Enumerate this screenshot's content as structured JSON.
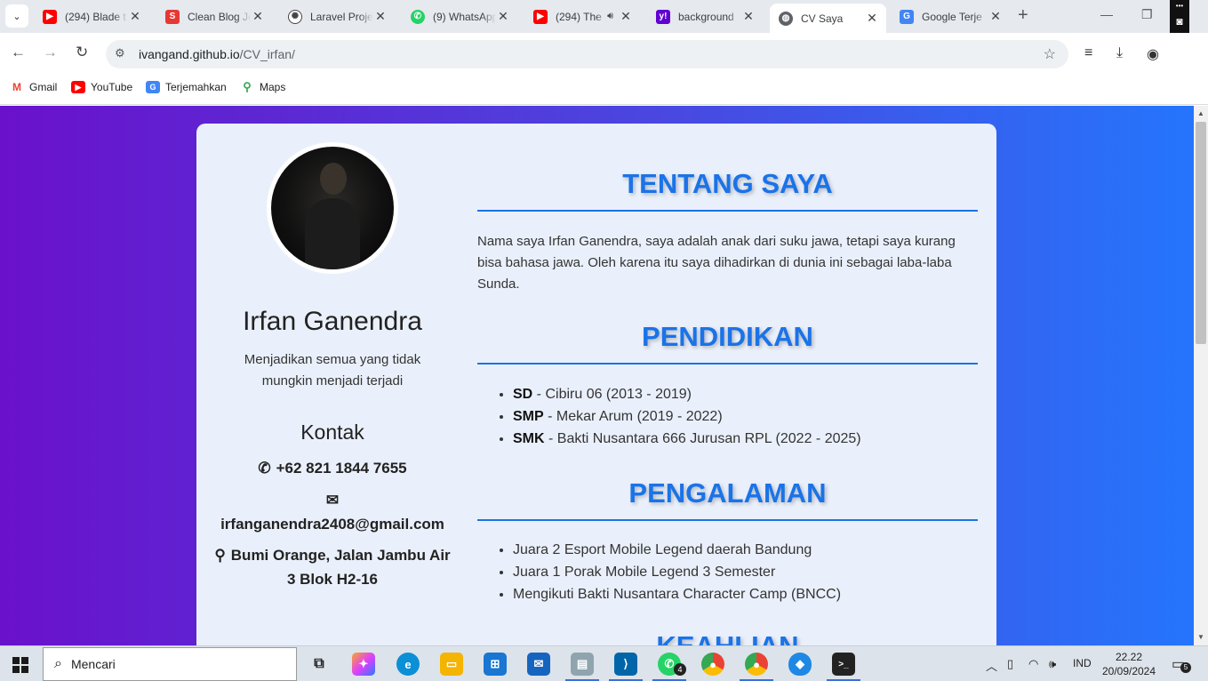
{
  "browser": {
    "tabs": [
      {
        "title": "(294) Blade t",
        "favicon": "youtube-icon",
        "color": "#ff0000"
      },
      {
        "title": "Clean Blog Je",
        "favicon": "s-logo-icon",
        "color": "#e53935"
      },
      {
        "title": "Laravel Proje",
        "favicon": "openai-icon",
        "color": "#444444"
      },
      {
        "title": "(9) WhatsApp",
        "favicon": "whatsapp-icon",
        "color": "#25d366"
      },
      {
        "title": "(294) The",
        "favicon": "youtube-icon",
        "color": "#ff0000"
      },
      {
        "title": "background",
        "favicon": "yahoo-icon",
        "color": "#6001d2"
      },
      {
        "title": "CV Saya",
        "favicon": "globe-icon",
        "color": "#5f6368"
      },
      {
        "title": "Google Terje",
        "favicon": "google-translate-icon",
        "color": "#4285f4"
      }
    ],
    "url_host": "ivangand.github.io",
    "url_path": "/CV_irfan/",
    "bookmarks": [
      {
        "label": "Gmail",
        "icon": "gmail-icon"
      },
      {
        "label": "YouTube",
        "icon": "youtube-icon"
      },
      {
        "label": "Terjemahkan",
        "icon": "google-translate-icon"
      },
      {
        "label": "Maps",
        "icon": "maps-pin-icon"
      }
    ]
  },
  "page": {
    "gradient_colors": [
      "#6a11cb",
      "#2575fc"
    ],
    "accent_color": "#1a73e8",
    "profile": {
      "name": "Irfan Ganendra",
      "tagline": "Menjadikan semua yang tidak mungkin menjadi terjadi",
      "contact_heading": "Kontak",
      "phone": "+62 821 1844 7655",
      "email": "irfanganendra2408@gmail.com",
      "address": "Bumi Orange, Jalan Jambu Air 3 Blok H2-16"
    },
    "about": {
      "title": "TENTANG SAYA",
      "text": "Nama saya Irfan Ganendra, saya adalah anak dari suku jawa, tetapi saya kurang bisa bahasa jawa. Oleh karena itu saya dihadirkan di dunia ini sebagai laba-laba Sunda."
    },
    "education": {
      "title": "PENDIDIKAN",
      "items": [
        {
          "level": "SD",
          "detail": " - Cibiru 06 (2013 - 2019)"
        },
        {
          "level": "SMP",
          "detail": " - Mekar Arum (2019 - 2022)"
        },
        {
          "level": "SMK",
          "detail": " - Bakti Nusantara 666 Jurusan RPL (2022 - 2025)"
        }
      ]
    },
    "experience": {
      "title": "PENGALAMAN",
      "items": [
        "Juara 2 Esport Mobile Legend daerah Bandung",
        "Juara 1 Porak Mobile Legend 3 Semester",
        "Mengikuti Bakti Nusantara Character Camp (BNCC)"
      ]
    },
    "skills": {
      "title": "KEAHLIAN"
    }
  },
  "taskbar": {
    "search_placeholder": "Mencari",
    "whatsapp_badge": "4",
    "language": "IND",
    "time": "22.22",
    "date": "20/09/2024",
    "notification_count": "5"
  }
}
